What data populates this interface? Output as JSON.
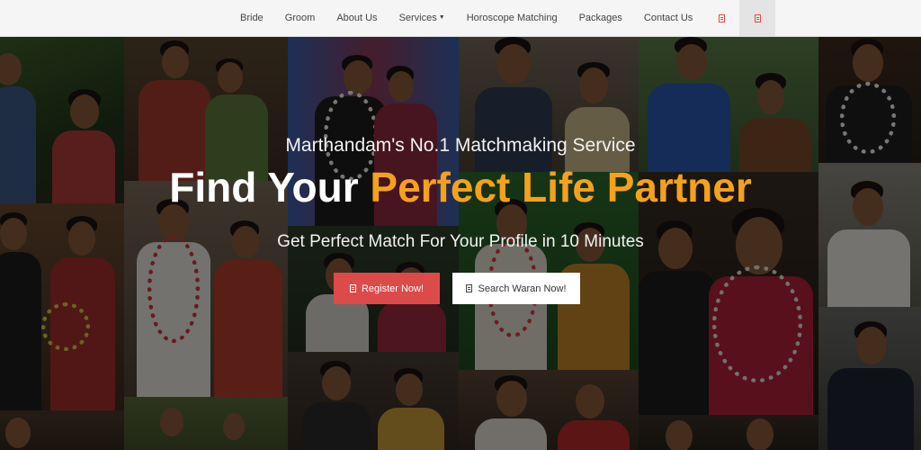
{
  "nav": {
    "items": [
      {
        "label": "Bride"
      },
      {
        "label": "Groom"
      },
      {
        "label": "About Us"
      },
      {
        "label": "Services",
        "has_dropdown": true
      },
      {
        "label": "Horoscope Matching"
      },
      {
        "label": "Packages"
      },
      {
        "label": "Contact Us"
      }
    ],
    "icons": [
      "document-icon",
      "document-icon"
    ]
  },
  "hero": {
    "tagline": "Marthandam's No.1 Matchmaking Service",
    "headline_part1": "Find Your ",
    "headline_accent": "Perfect Life Partner",
    "subline": "Get Perfect Match For Your Profile in 10 Minutes",
    "register_label": "Register Now!",
    "search_label": "Search Waran Now!"
  },
  "colors": {
    "accent": "#f4a21c",
    "register_button": "#dc4a4a",
    "navbar_bg": "#f5f5f5"
  }
}
